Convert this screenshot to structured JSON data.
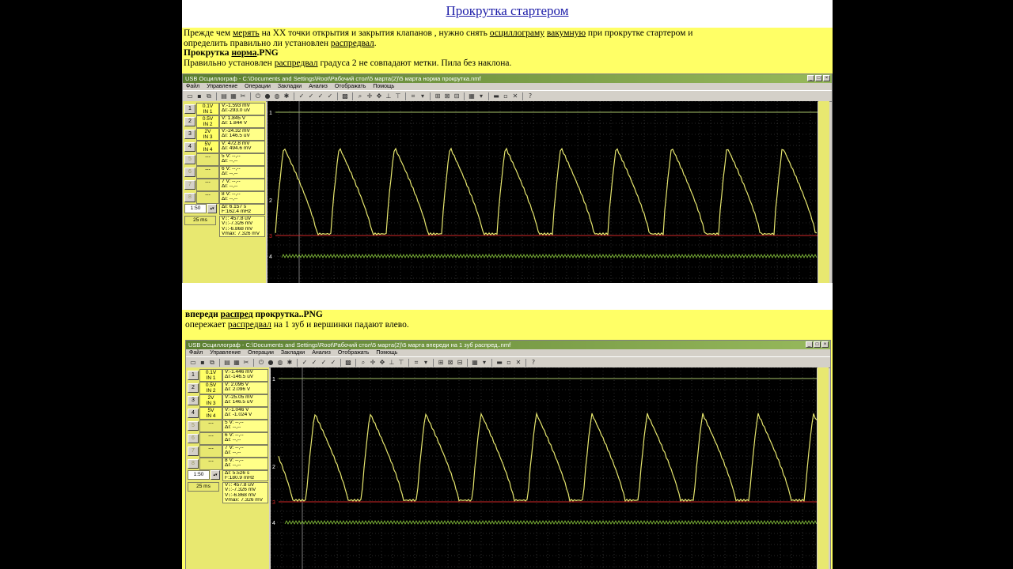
{
  "page": {
    "title": "Прокрутка стартером",
    "intro_line1_a": "Прежде чем ",
    "intro_link_merit": "мерять",
    "intro_line1_b": " на ХХ точки открытия и закрытия клапанов , нужно снять ",
    "intro_link_osc": "осциллограму",
    "intro_line1_c": " ",
    "intro_link_vac": "вакумную",
    "intro_line1_d": " при прокрутке стартером и",
    "intro_line2_a": "определить правильно ли установлен ",
    "intro_link_dist": "распредвал",
    "intro_line2_b": ".",
    "intro_bold_a": "Прокрутка ",
    "intro_bold_link": "норма",
    "intro_bold_b": ".PNG",
    "intro_line4_a": "Правильно установлен ",
    "intro_line4_link": "распредвал",
    "intro_line4_b": " градуса 2 не совпадают метки. Пила без наклона.",
    "cap2_bold_a": "впереди ",
    "cap2_bold_link": "распред",
    "cap2_bold_b": " прокрутка..PNG",
    "cap2_line2_a": "опережает ",
    "cap2_line2_link": "распредвал",
    "cap2_line2_b": " на 1 зуб  и вершинки падают влево."
  },
  "menu": [
    "Файл",
    "Управление",
    "Операции",
    "Закладки",
    "Анализ",
    "Отображать",
    "Помощь"
  ],
  "window1": {
    "title": "USB Осциллограф - C:\\Documents and Settings\\Root\\Рабочий стол\\5 марта(2)\\5 марта норма прокрутка.nmf",
    "channels": [
      {
        "btn": "1",
        "scale": "0.1V",
        "input": "IN 1",
        "v": "V:-1.593 mV",
        "dv": "ΔI:-293.0 uV"
      },
      {
        "btn": "2",
        "scale": "0.5V",
        "input": "IN 2",
        "v": "V: 1.845 V",
        "dv": "ΔI: 1.844 V"
      },
      {
        "btn": "3",
        "scale": "2V",
        "input": "IN 3",
        "v": "V:-24.32 mV",
        "dv": "ΔI: 146.5 uV"
      },
      {
        "btn": "4",
        "scale": "5V",
        "input": "IN 4",
        "v": "V: 472.8 mV",
        "dv": "ΔI: 494.6 mV"
      }
    ],
    "time_scale": "1:50",
    "time_div": "25 ms",
    "delta_t": "ΔI: 6.157 s",
    "freq": "F:162.4 mHz",
    "meas": [
      "V↕: 457.8 uV",
      "V↕:-7.326 mV",
      "V↕:-6.868 mV",
      "Vmax: 7.326 mV"
    ]
  },
  "window2": {
    "title": "USB Осциллограф - C:\\Documents and Settings\\Root\\Рабочий стол\\5 марта(2)\\5 марта впереди на 1 зуб распред..nmf",
    "channels": [
      {
        "btn": "1",
        "scale": "0.1V",
        "input": "IN 1",
        "v": "V:-1.446 mV",
        "dv": "ΔI:-146.5 uV"
      },
      {
        "btn": "2",
        "scale": "0.5V",
        "input": "IN 2",
        "v": "V: 2.096 V",
        "dv": "ΔI: 2.096 V"
      },
      {
        "btn": "3",
        "scale": "2V",
        "input": "IN 3",
        "v": "V:-25.05 mV",
        "dv": "ΔI: 146.5 uV"
      },
      {
        "btn": "4",
        "scale": "5V",
        "input": "IN 4",
        "v": "V:-1.046 V",
        "dv": "ΔI: -1.024 V"
      }
    ],
    "time_scale": "1:50",
    "time_div": "25 ms",
    "delta_t": "ΔI: 5.526 s",
    "freq": "F:180.9 mHz",
    "meas": [
      "V↕: 457.8 uV",
      "V↕:-7.326 mV",
      "V↕:-6.868 mV",
      "Vmax: 7.326 mV"
    ]
  },
  "empty_channels": [
    "5",
    "6",
    "7",
    "8"
  ],
  "empty_value": "--,--",
  "empty_scale": "---",
  "reading_labels": {
    "v": "V:",
    "dv": "ΔI:"
  },
  "colors": {
    "page_bg": "#ffff66",
    "trace_yellow": "#e6e66e",
    "trace_red": "#d22828",
    "trace_green": "#8ccc3c",
    "grid": "#555555"
  }
}
